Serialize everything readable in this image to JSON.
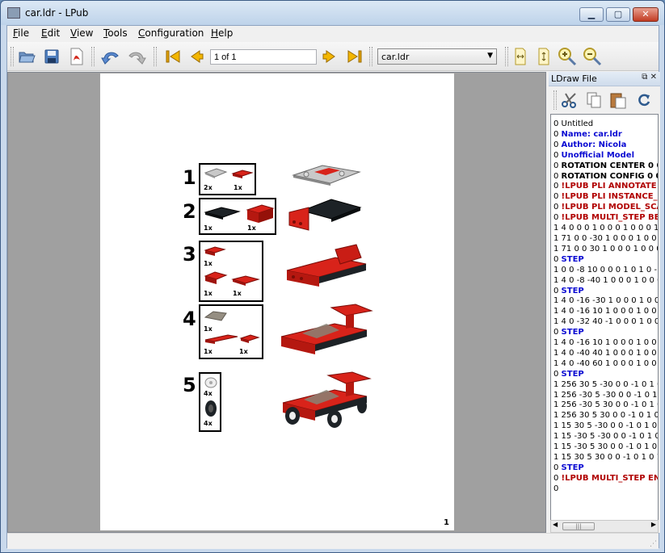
{
  "window": {
    "title": "car.ldr - LPub"
  },
  "title_buttons": {
    "minimize": "▁",
    "maximize": "▢",
    "close": "✕"
  },
  "menu": [
    {
      "label": "File",
      "ul": "F",
      "rest": "ile"
    },
    {
      "label": "Edit",
      "ul": "E",
      "rest": "dit"
    },
    {
      "label": "View",
      "ul": "V",
      "rest": "iew"
    },
    {
      "label": "Tools",
      "ul": "T",
      "rest": "ools"
    },
    {
      "label": "Configuration",
      "ul": "C",
      "rest": "onfiguration"
    },
    {
      "label": "Help",
      "ul": "H",
      "rest": "elp"
    }
  ],
  "toolbar": {
    "icons": [
      "open-folder-icon",
      "save-disk-icon",
      "pdf-export-icon",
      "undo-icon",
      "redo-icon",
      "first-page-icon",
      "previous-page-icon",
      "next-page-icon",
      "last-page-icon",
      "fit-width-icon",
      "fit-page-icon",
      "zoom-in-icon",
      "zoom-out-icon"
    ],
    "page_field": "1 of 1",
    "submodel_combo": "car.ldr"
  },
  "page": {
    "steps": [
      {
        "number": "1",
        "parts": [
          {
            "qty": "2x",
            "color": "#b9b9b9"
          },
          {
            "qty": "1x",
            "color": "#cc1a12"
          }
        ]
      },
      {
        "number": "2",
        "parts": [
          {
            "qty": "1x",
            "color": "#1d2226"
          },
          {
            "qty": "1x",
            "color": "#cc1a12"
          }
        ]
      },
      {
        "number": "3",
        "parts": [
          {
            "qty": "1x",
            "color": "#cc1a12"
          },
          {
            "qty": "1x",
            "color": "#cc1a12"
          },
          {
            "qty": "1x",
            "color": "#cc1a12"
          }
        ]
      },
      {
        "number": "4",
        "parts": [
          {
            "qty": "1x",
            "color": "#7d756a"
          },
          {
            "qty": "1x",
            "color": "#cc1a12"
          },
          {
            "qty": "1x",
            "color": "#cc1a12"
          }
        ]
      },
      {
        "number": "5",
        "parts": [
          {
            "qty": "4x",
            "color": "#e2e2e2"
          },
          {
            "qty": "4x",
            "color": "#1d2226"
          }
        ]
      }
    ],
    "page_number": "1"
  },
  "dock": {
    "title": "LDraw File",
    "float_icon": "float-icon",
    "close_label": "✕",
    "tool_icons": [
      "cut-icon",
      "copy-icon",
      "paste-icon",
      "refresh-icon"
    ],
    "lines": [
      {
        "text": "0 Untitled",
        "style": "plain"
      },
      {
        "prefix": "0 ",
        "text": "Name: car.ldr",
        "style": "blue"
      },
      {
        "prefix": "0 ",
        "text": "Author: Nicola",
        "style": "blue"
      },
      {
        "prefix": "0 ",
        "text": "Unofficial Model",
        "style": "blue"
      },
      {
        "prefix": "0 ",
        "text": "ROTATION CENTER 0 0 0",
        "style": "black"
      },
      {
        "prefix": "0 ",
        "text": "ROTATION CONFIG 0 0",
        "style": "black"
      },
      {
        "prefix": "0 ",
        "text": "!LPUB PLI ANNOTATE F",
        "style": "red"
      },
      {
        "prefix": "0 ",
        "text": "!LPUB PLI INSTANCE_C",
        "style": "red"
      },
      {
        "prefix": "0 ",
        "text": "!LPUB PLI MODEL_SCA",
        "style": "red"
      },
      {
        "prefix": "0 ",
        "text": "!LPUB MULTI_STEP BE",
        "style": "red"
      },
      {
        "text": "1 4 0 0 0 1 0 0 0 1 0 0 0 1 3",
        "style": "plain"
      },
      {
        "text": "1 71 0 0 -30 1 0 0 0 1 0 0 0",
        "style": "plain"
      },
      {
        "text": "1 71 0 0 30 1 0 0 0 1 0 0 0 1",
        "style": "plain"
      },
      {
        "prefix": "0 ",
        "text": "STEP",
        "style": "blue"
      },
      {
        "text": "1 0 0 -8 10 0 0 0 1 0 1 0 -1 0",
        "style": "plain"
      },
      {
        "text": "1 4 0 -8 -40 1 0 0 0 1 0 0 0 1",
        "style": "plain"
      },
      {
        "prefix": "0 ",
        "text": "STEP",
        "style": "blue"
      },
      {
        "text": "1 4 0 -16 -30 1 0 0 0 1 0 0 0",
        "style": "plain"
      },
      {
        "text": "1 4 0 -16 10 1 0 0 0 1 0 0 0 1",
        "style": "plain"
      },
      {
        "text": "1 4 0 -32 40 -1 0 0 0 1 0 0 0",
        "style": "plain"
      },
      {
        "prefix": "0 ",
        "text": "STEP",
        "style": "blue"
      },
      {
        "text": "1 4 0 -16 10 1 0 0 0 1 0 0 0 1",
        "style": "plain"
      },
      {
        "text": "1 4 0 -40 40 1 0 0 0 1 0 0 0 1",
        "style": "plain"
      },
      {
        "text": "1 4 0 -40 60 1 0 0 0 1 0 0 0 1",
        "style": "plain"
      },
      {
        "prefix": "0 ",
        "text": "STEP",
        "style": "blue"
      },
      {
        "text": "1 256 30 5 -30 0 0 -1 0 1 0 1",
        "style": "plain"
      },
      {
        "text": "1 256 -30 5 -30 0 0 -1 0 1 0 1",
        "style": "plain"
      },
      {
        "text": "1 256 -30 5 30 0 0 -1 0 1 0 1",
        "style": "plain"
      },
      {
        "text": "1 256 30 5 30 0 0 -1 0 1 0 1 0",
        "style": "plain"
      },
      {
        "text": "1 15 30 5 -30 0 0 -1 0 1 0 1 0",
        "style": "plain"
      },
      {
        "text": "1 15 -30 5 -30 0 0 -1 0 1 0 -1",
        "style": "plain"
      },
      {
        "text": "1 15 -30 5 30 0 0 -1 0 1 0 -1 0",
        "style": "plain"
      },
      {
        "text": "1 15 30 5 30 0 0 -1 0 1 0 1 0 1",
        "style": "plain"
      },
      {
        "prefix": "0 ",
        "text": "STEP",
        "style": "blue"
      },
      {
        "prefix": "0 ",
        "text": "!LPUB MULTI_STEP EN",
        "style": "red"
      },
      {
        "text": "0",
        "style": "plain"
      }
    ],
    "scroll_thumb": "|||"
  },
  "status": {
    "text": ""
  }
}
